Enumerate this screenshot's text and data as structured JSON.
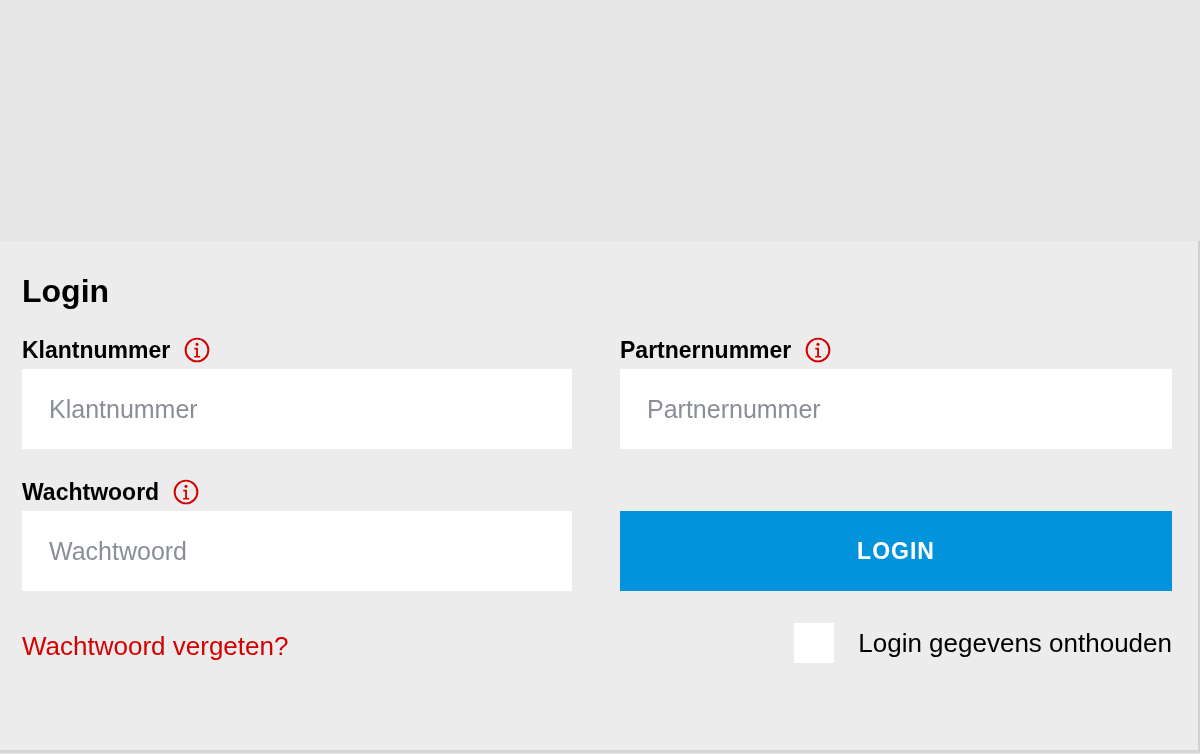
{
  "form": {
    "title": "Login",
    "fields": [
      {
        "label": "Klantnummer",
        "placeholder": "Klantnummer"
      },
      {
        "label": "Partnernummer",
        "placeholder": "Partnernummer"
      },
      {
        "label": "Wachtwoord",
        "placeholder": "Wachtwoord"
      }
    ],
    "login_button": "LOGIN",
    "forgot_link": "Wachtwoord vergeten?",
    "remember": {
      "label": "Login gegevens onthouden",
      "checked": false
    }
  }
}
